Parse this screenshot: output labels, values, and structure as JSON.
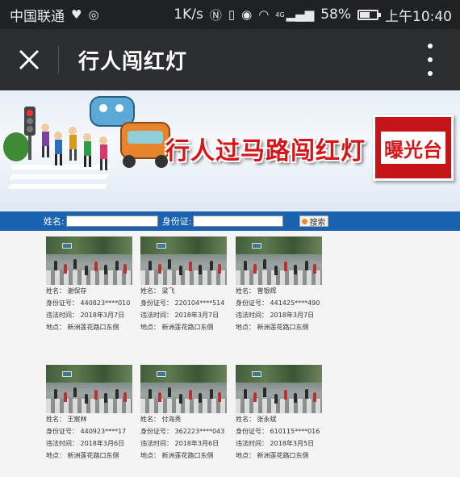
{
  "status_bar": {
    "carrier": "中国联通",
    "speed": "1K/s",
    "network": "4G",
    "battery": "58%",
    "battery_level": 0.58,
    "time": "上午10:40",
    "icons": [
      "heart-pulse-icon",
      "shield-icon",
      "nfc-icon",
      "vibrate-icon",
      "eye-icon",
      "wifi-icon",
      "signal-icon",
      "battery-icon"
    ]
  },
  "title_bar": {
    "title": "行人闯红灯",
    "close_icon": "close-icon",
    "menu_icon": "more-vertical-icon"
  },
  "banner": {
    "title": "行人过马路闯红灯",
    "badge": "曝光台"
  },
  "search": {
    "name_label": "姓名:",
    "id_label": "身份证:",
    "button_label": "搜索"
  },
  "records": [
    {
      "name": "姓名： 谢保存",
      "id": "身份证号： 440823****010",
      "time": "违法时间： 2018年3月7日",
      "place": "地点： 新洲莲花路口东侧"
    },
    {
      "name": "姓名： 梁飞",
      "id": "身份证号： 220104****514",
      "time": "违法时间： 2018年3月7日",
      "place": "地点： 新洲莲花路口东侧"
    },
    {
      "name": "姓名： 曾银辉",
      "id": "身份证号： 441425****490",
      "time": "违法时间： 2018年3月7日",
      "place": "地点： 新洲莲花路口东侧"
    },
    {
      "name": "姓名： 王宸林",
      "id": "身份证号： 440923****17",
      "time": "违法时间： 2018年3月6日",
      "place": "地点： 新洲莲花路口东侧"
    },
    {
      "name": "姓名： 付海秀",
      "id": "身份证号： 362223****043",
      "time": "违法时间： 2018年3月6日",
      "place": "地点： 新洲莲花路口东侧"
    },
    {
      "name": "姓名： 张永斌",
      "id": "身份证号： 610115****016",
      "time": "违法时间： 2018年3月5日",
      "place": "地点： 新洲莲花路口东侧"
    }
  ],
  "colors": {
    "status_bg": "#1f2124",
    "titlebar_bg": "#2b2d31",
    "search_bg": "#1b62b0",
    "banner_red": "#d71418"
  }
}
